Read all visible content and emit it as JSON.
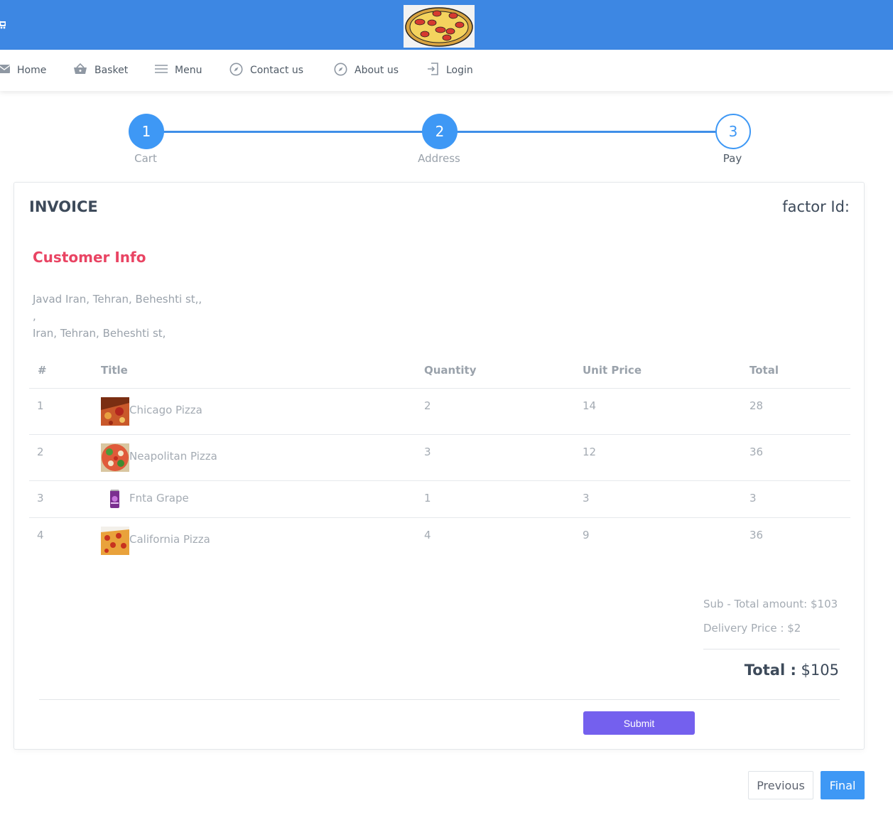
{
  "nav": {
    "items": [
      {
        "label": "Home",
        "icon": "mail-icon"
      },
      {
        "label": "Basket",
        "icon": "basket-icon"
      },
      {
        "label": "Menu",
        "icon": "menu-icon"
      },
      {
        "label": "Contact us",
        "icon": "compass-icon"
      },
      {
        "label": "About us",
        "icon": "compass-icon"
      },
      {
        "label": "Login",
        "icon": "login-icon"
      }
    ]
  },
  "stepper": {
    "steps": [
      {
        "number": "1",
        "label": "Cart",
        "state": "done"
      },
      {
        "number": "2",
        "label": "Address",
        "state": "done"
      },
      {
        "number": "3",
        "label": "Pay",
        "state": "current"
      }
    ]
  },
  "invoice": {
    "title": "INVOICE",
    "factor_label": "factor Id:",
    "customer_title": "Customer Info",
    "customer_lines": [
      "Javad Iran, Tehran, Beheshti st,,",
      ",",
      "Iran, Tehran, Beheshti st,"
    ],
    "columns": [
      "#",
      "Title",
      "Quantity",
      "Unit Price",
      "Total"
    ],
    "rows": [
      {
        "index": "1",
        "title": "Chicago Pizza",
        "quantity": "2",
        "unit_price": "14",
        "total": "28",
        "thumb": "pizza-image"
      },
      {
        "index": "2",
        "title": "Neapolitan Pizza",
        "quantity": "3",
        "unit_price": "12",
        "total": "36",
        "thumb": "pizza-image"
      },
      {
        "index": "3",
        "title": "Fnta Grape",
        "quantity": "1",
        "unit_price": "3",
        "total": "3",
        "thumb": "soda-can-image"
      },
      {
        "index": "4",
        "title": "California Pizza",
        "quantity": "4",
        "unit_price": "9",
        "total": "36",
        "thumb": "pizza-image"
      }
    ],
    "subtotal": "Sub - Total amount: $103",
    "delivery": "Delivery Price : $2",
    "total_label": "Total :",
    "total_value": "$105",
    "submit_label": "Submit"
  },
  "buttons": {
    "previous": "Previous",
    "final": "Final"
  },
  "colors": {
    "header": "#3d87e3",
    "accent": "#3e98f5",
    "customer_title": "#e94463",
    "submit": "#7460ee"
  }
}
